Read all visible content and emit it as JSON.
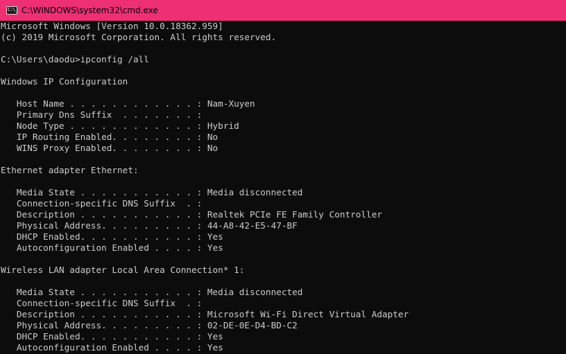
{
  "window": {
    "title": "C:\\WINDOWS\\system32\\cmd.exe",
    "title_bar_color": "#ee2f73",
    "icon": "command-prompt-icon",
    "icon_glyph": "C:\\_"
  },
  "console": {
    "background": "#0c0c0c",
    "foreground": "#cccccc",
    "lines": [
      "Microsoft Windows [Version 10.0.18362.959]",
      "(c) 2019 Microsoft Corporation. All rights reserved.",
      "",
      "C:\\Users\\daodu>ipconfig /all",
      "",
      "Windows IP Configuration",
      "",
      "   Host Name . . . . . . . . . . . . : Nam-Xuyen",
      "   Primary Dns Suffix  . . . . . . . :",
      "   Node Type . . . . . . . . . . . . : Hybrid",
      "   IP Routing Enabled. . . . . . . . : No",
      "   WINS Proxy Enabled. . . . . . . . : No",
      "",
      "Ethernet adapter Ethernet:",
      "",
      "   Media State . . . . . . . . . . . : Media disconnected",
      "   Connection-specific DNS Suffix  . :",
      "   Description . . . . . . . . . . . : Realtek PCIe FE Family Controller",
      "   Physical Address. . . . . . . . . : 44-A8-42-E5-47-BF",
      "   DHCP Enabled. . . . . . . . . . . : Yes",
      "   Autoconfiguration Enabled . . . . : Yes",
      "",
      "Wireless LAN adapter Local Area Connection* 1:",
      "",
      "   Media State . . . . . . . . . . . : Media disconnected",
      "   Connection-specific DNS Suffix  . :",
      "   Description . . . . . . . . . . . : Microsoft Wi-Fi Direct Virtual Adapter",
      "   Physical Address. . . . . . . . . : 02-DE-0E-D4-BD-C2",
      "   DHCP Enabled. . . . . . . . . . . : Yes",
      "   Autoconfiguration Enabled . . . . : Yes"
    ]
  }
}
